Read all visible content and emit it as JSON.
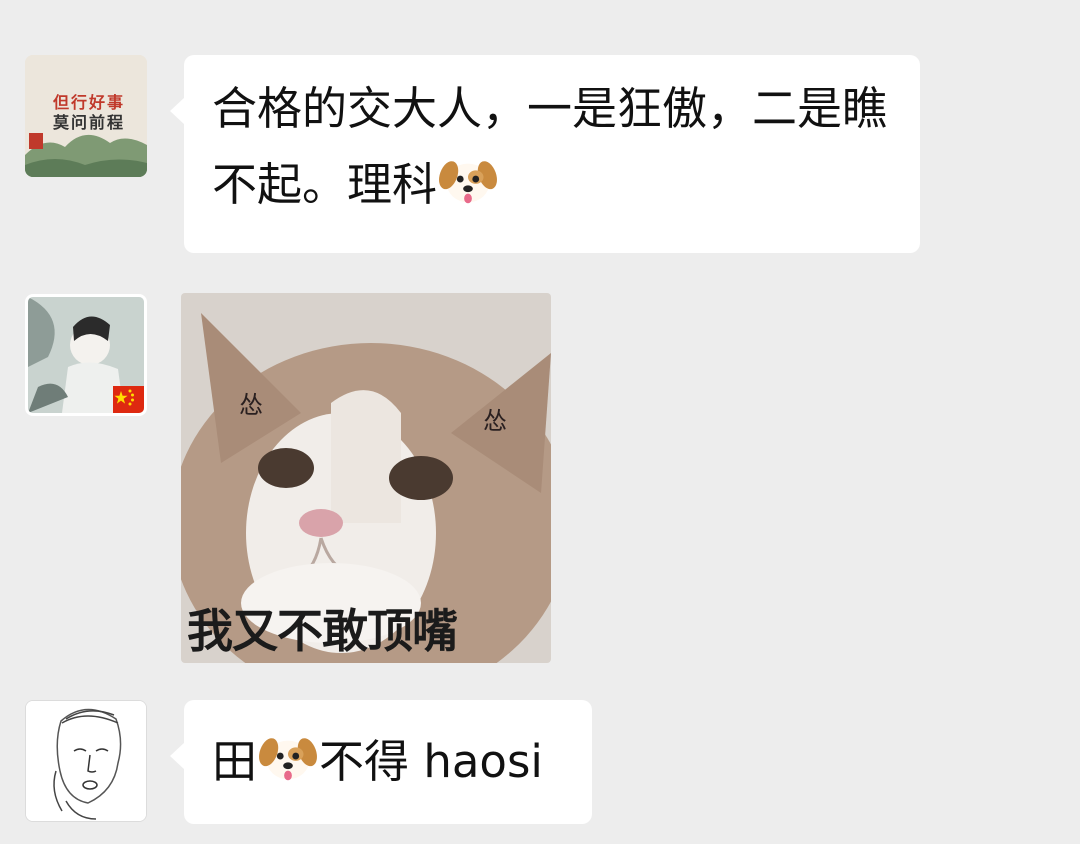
{
  "messages": [
    {
      "type": "text",
      "text_before_emoji": "合格的交大人，一是狂傲，二是瞧不起。理科",
      "emoji": "dog-face-emoji",
      "avatar": {
        "kind": "landscape-calligraphy",
        "line1": "但行好事",
        "line2": "莫问前程"
      }
    },
    {
      "type": "sticker",
      "sticker": {
        "subject": "cat-face",
        "mark_left": "怂",
        "mark_right": "怂",
        "caption": "我又不敢顶嘴"
      },
      "avatar": {
        "kind": "ink-painting-with-flag",
        "badge": "china-flag-icon"
      }
    },
    {
      "type": "text",
      "text_part1": "田",
      "emoji": "dog-face-emoji",
      "text_part2": "不得 haosi",
      "avatar": {
        "kind": "line-sketch-portrait"
      }
    }
  ],
  "colors": {
    "background": "#ededed",
    "bubble": "#ffffff",
    "text": "#111111"
  }
}
